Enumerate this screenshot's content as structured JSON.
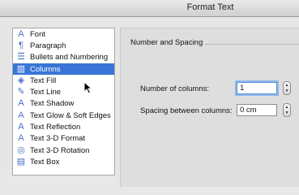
{
  "window": {
    "title": "Format Text"
  },
  "sidebar": {
    "items": [
      {
        "label": "Font",
        "icon": "font-icon",
        "glyph": "A",
        "selected": false
      },
      {
        "label": "Paragraph",
        "icon": "paragraph-icon",
        "glyph": "¶",
        "selected": false
      },
      {
        "label": "Bullets and Numbering",
        "icon": "bullets-icon",
        "glyph": "☰",
        "selected": false
      },
      {
        "label": "Columns",
        "icon": "columns-icon",
        "glyph": "▥",
        "selected": true
      },
      {
        "label": "Text Fill",
        "icon": "paint-bucket-icon",
        "glyph": "◈",
        "selected": false
      },
      {
        "label": "Text Line",
        "icon": "pencil-icon",
        "glyph": "✎",
        "selected": false
      },
      {
        "label": "Text Shadow",
        "icon": "shadow-a-icon",
        "glyph": "A",
        "selected": false
      },
      {
        "label": "Text Glow & Soft Edges",
        "icon": "glow-a-icon",
        "glyph": "A",
        "selected": false
      },
      {
        "label": "Text Reflection",
        "icon": "reflection-a-icon",
        "glyph": "A",
        "selected": false
      },
      {
        "label": "Text 3-D Format",
        "icon": "3d-format-a-icon",
        "glyph": "A",
        "selected": false
      },
      {
        "label": "Text 3-D Rotation",
        "icon": "3d-rotation-icon",
        "glyph": "◎",
        "selected": false
      },
      {
        "label": "Text Box",
        "icon": "text-box-icon",
        "glyph": "▤",
        "selected": false
      }
    ]
  },
  "panel": {
    "group_title": "Number and Spacing",
    "number_of_columns": {
      "label": "Number of columns:",
      "value": "1"
    },
    "spacing_between_columns": {
      "label": "Spacing between columns:",
      "value": "0 cm"
    }
  },
  "colors": {
    "selection": "#3875d7",
    "focus_ring": "#8fb7ea"
  }
}
